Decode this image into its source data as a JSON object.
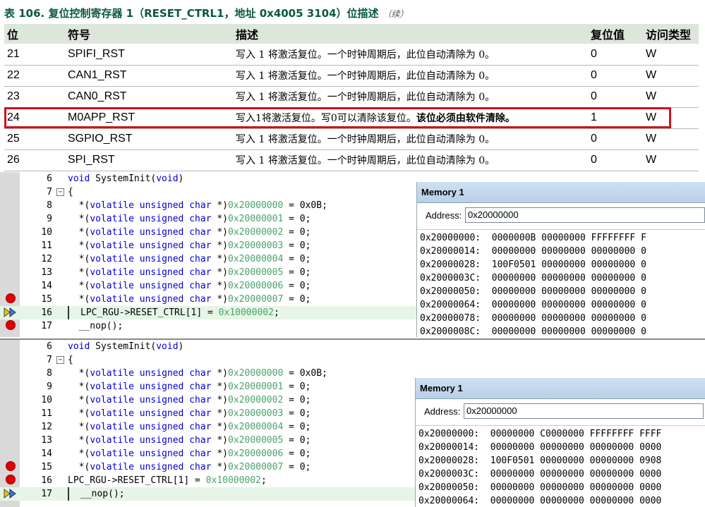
{
  "table": {
    "caption": "表 106.   复位控制寄存器 1（RESET_CTRL1，地址 0x4005 3104）位描述",
    "caption_cont": "（续）",
    "headers": [
      "位",
      "符号",
      "描述",
      "复位值",
      "访问类型"
    ],
    "rows": [
      {
        "bit": "21",
        "symbol": "SPIFI_RST",
        "desc": "写入 1 将激活复位。一个时钟周期后，此位自动清除为 0。",
        "desc_bold": "",
        "reset": "0",
        "access": "W"
      },
      {
        "bit": "22",
        "symbol": "CAN1_RST",
        "desc": "写入 1 将激活复位。一个时钟周期后，此位自动清除为 0。",
        "desc_bold": "",
        "reset": "0",
        "access": "W"
      },
      {
        "bit": "23",
        "symbol": "CAN0_RST",
        "desc": "写入 1 将激活复位。一个时钟周期后，此位自动清除为 0。",
        "desc_bold": "",
        "reset": "0",
        "access": "W"
      },
      {
        "bit": "24",
        "symbol": "M0APP_RST",
        "desc": "写入1将激活复位。写0可以清除该复位。",
        "desc_bold": "该位必须由软件清除。",
        "reset": "1",
        "access": "W"
      },
      {
        "bit": "25",
        "symbol": "SGPIO_RST",
        "desc": "写入 1 将激活复位。一个时钟周期后，此位自动清除为 0。",
        "desc_bold": "",
        "reset": "0",
        "access": "W"
      },
      {
        "bit": "26",
        "symbol": "SPI_RST",
        "desc": "写入 1 将激活复位。一个时钟周期后，此位自动清除为 0。",
        "desc_bold": "",
        "reset": "0",
        "access": "W"
      }
    ]
  },
  "code": {
    "l6": "void SystemInit(void)",
    "l7": "{",
    "vol_prefix": "*(volatile unsigned char *)",
    "addr0": "0x20000000",
    "val0": " = 0x0B;",
    "addr1": "0x20000001",
    "val1": " = 0;",
    "addr2": "0x20000002",
    "val2": " = 0;",
    "addr3": "0x20000003",
    "val3": " = 0;",
    "addr4": "0x20000004",
    "val4": " = 0;",
    "addr5": "0x20000005",
    "val5": " = 0;",
    "addr6": "0x20000006",
    "val6": " = 0;",
    "addr7": "0x20000007",
    "val7": " = 0;",
    "l16a": "LPC_RGU->RESET_CTRL[1] = ",
    "l16b": "0x10000002",
    "l16c": ";",
    "l17": "__nop();",
    "line_numbers": [
      "6",
      "7",
      "8",
      "9",
      "10",
      "11",
      "12",
      "13",
      "14",
      "15",
      "16",
      "17"
    ]
  },
  "memory1": {
    "title": "Memory 1",
    "address_label": "Address:",
    "address_value": "0x20000000",
    "rows": [
      "0x20000000:  0000000B 00000000 FFFFFFFF F",
      "0x20000014:  00000000 00000000 00000000 0",
      "0x20000028:  100F0501 00000000 00000000 0",
      "0x2000003C:  00000000 00000000 00000000 0",
      "0x20000050:  00000000 00000000 00000000 0",
      "0x20000064:  00000000 00000000 00000000 0",
      "0x20000078:  00000000 00000000 00000000 0",
      "0x2000008C:  00000000 00000000 00000000 0"
    ]
  },
  "memory2": {
    "title": "Memory 1",
    "address_label": "Address:",
    "address_value": "0x20000000",
    "rows": [
      "0x20000000:  00000000 C0000000 FFFFFFFF FFFF",
      "0x20000014:  00000000 00000000 00000000 0000",
      "0x20000028:  100F0501 00000000 00000000 0908",
      "0x2000003C:  00000000 00000000 00000000 0000",
      "0x20000050:  00000000 00000000 00000000 0000",
      "0x20000064:  00000000 00000000 00000000 0000"
    ]
  },
  "colors": {
    "highlight_border": "#d0121b",
    "header_bg": "#dde6da",
    "caption": "#0b5a3c",
    "keyword": "#0000d6",
    "hex_literal": "#4aa36a"
  }
}
